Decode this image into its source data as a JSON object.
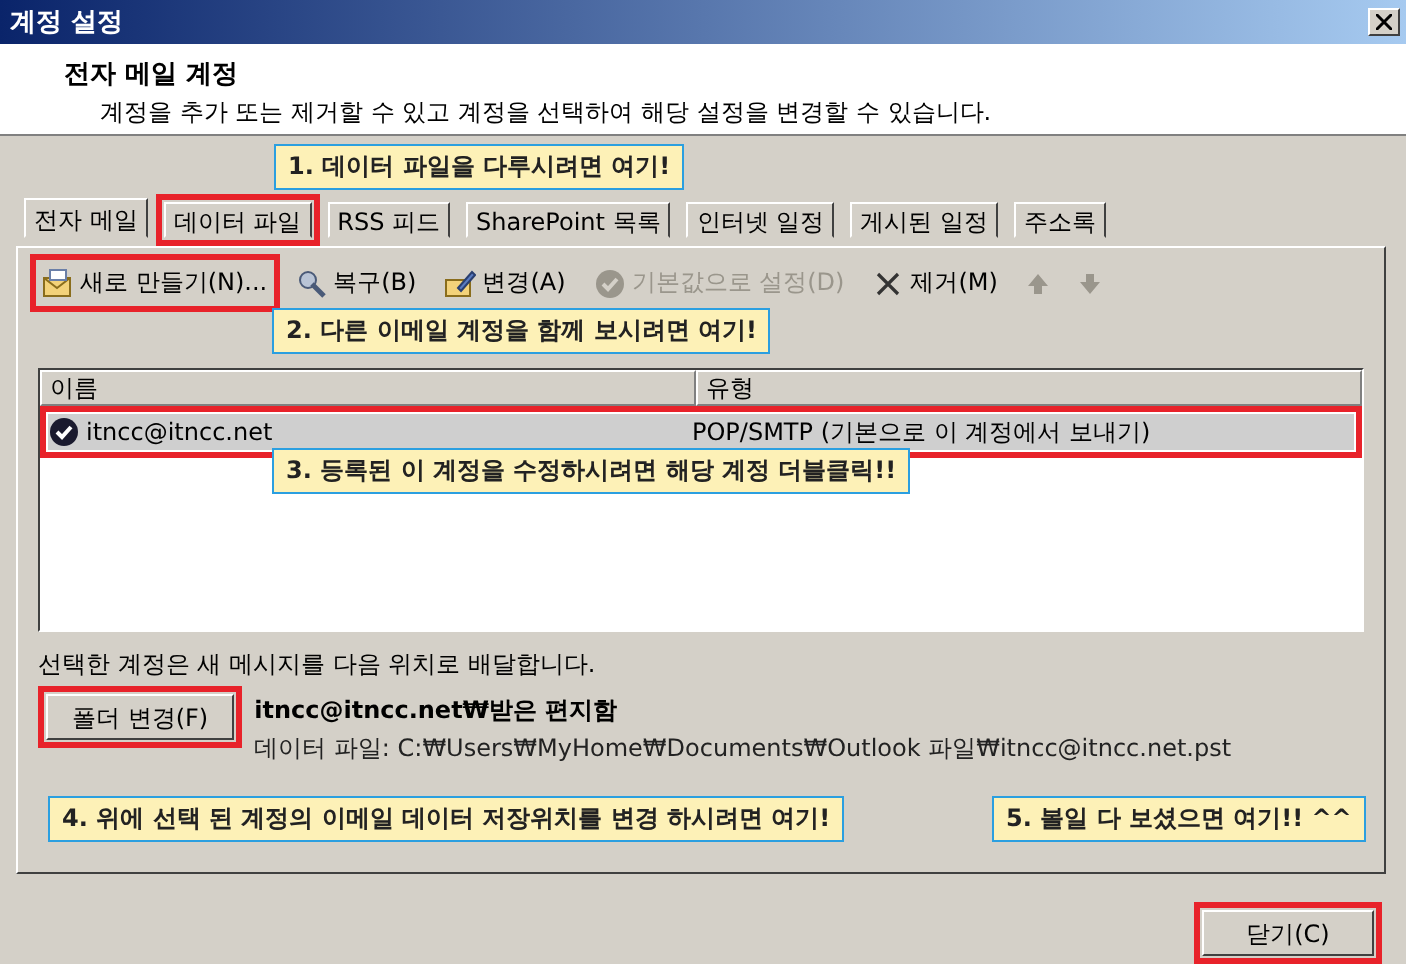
{
  "window": {
    "title": "계정 설정"
  },
  "header": {
    "title": "전자 메일 계정",
    "description": "계정을 추가 또는 제거할 수 있고 계정을 선택하여 해당 설정을 변경할 수 있습니다."
  },
  "tabs": [
    {
      "label": "전자 메일",
      "selected": true,
      "highlighted": false
    },
    {
      "label": "데이터 파일",
      "selected": false,
      "highlighted": true
    },
    {
      "label": "RSS 피드",
      "selected": false,
      "highlighted": false
    },
    {
      "label": "SharePoint 목록",
      "selected": false,
      "highlighted": false
    },
    {
      "label": "인터넷 일정",
      "selected": false,
      "highlighted": false
    },
    {
      "label": "게시된 일정",
      "selected": false,
      "highlighted": false
    },
    {
      "label": "주소록",
      "selected": false,
      "highlighted": false
    }
  ],
  "toolbar": [
    {
      "kind": "new",
      "label": "새로 만들기(N)...",
      "disabled": false,
      "highlighted": true
    },
    {
      "kind": "repair",
      "label": "복구(B)",
      "disabled": false,
      "highlighted": false
    },
    {
      "kind": "change",
      "label": "변경(A)",
      "disabled": false,
      "highlighted": false
    },
    {
      "kind": "default",
      "label": "기본값으로 설정(D)",
      "disabled": true,
      "highlighted": false
    },
    {
      "kind": "remove",
      "label": "제거(M)",
      "disabled": false,
      "highlighted": false
    },
    {
      "kind": "up",
      "disabled": true,
      "highlighted": false
    },
    {
      "kind": "down",
      "disabled": true,
      "highlighted": false
    }
  ],
  "list": {
    "columns": [
      "이름",
      "유형"
    ],
    "rows": [
      {
        "name": "itncc@itncc.net",
        "type": "POP/SMTP (기본으로 이 계정에서 보내기)",
        "selected": true,
        "highlighted": true
      }
    ]
  },
  "delivery": {
    "text": "선택한 계정은 새 메시지를 다음 위치로 배달합니다.",
    "button": {
      "label": "폴더 변경(F)",
      "highlighted": true
    },
    "folder": "itncc@itncc.net₩받은 편지함",
    "data_file": "데이터 파일: C:₩Users₩MyHome₩Documents₩Outlook 파일₩itncc@itncc.net.pst"
  },
  "close_button": {
    "label": "닫기(C)",
    "highlighted": true
  },
  "callouts": [
    {
      "text": "1. 데이터 파일을 다루시려면 여기!"
    },
    {
      "text": "2. 다른 이메일 계정을 함께 보시려면 여기!"
    },
    {
      "text": "3. 등록된 이 계정을 수정하시려면 해당 계정 더블클릭!!"
    },
    {
      "text": "4. 위에 선택 된 계정의 이메일 데이터 저장위치를 변경 하시려면 여기!"
    },
    {
      "text": "5. 볼일 다 보셨으면 여기!! ^^"
    }
  ]
}
